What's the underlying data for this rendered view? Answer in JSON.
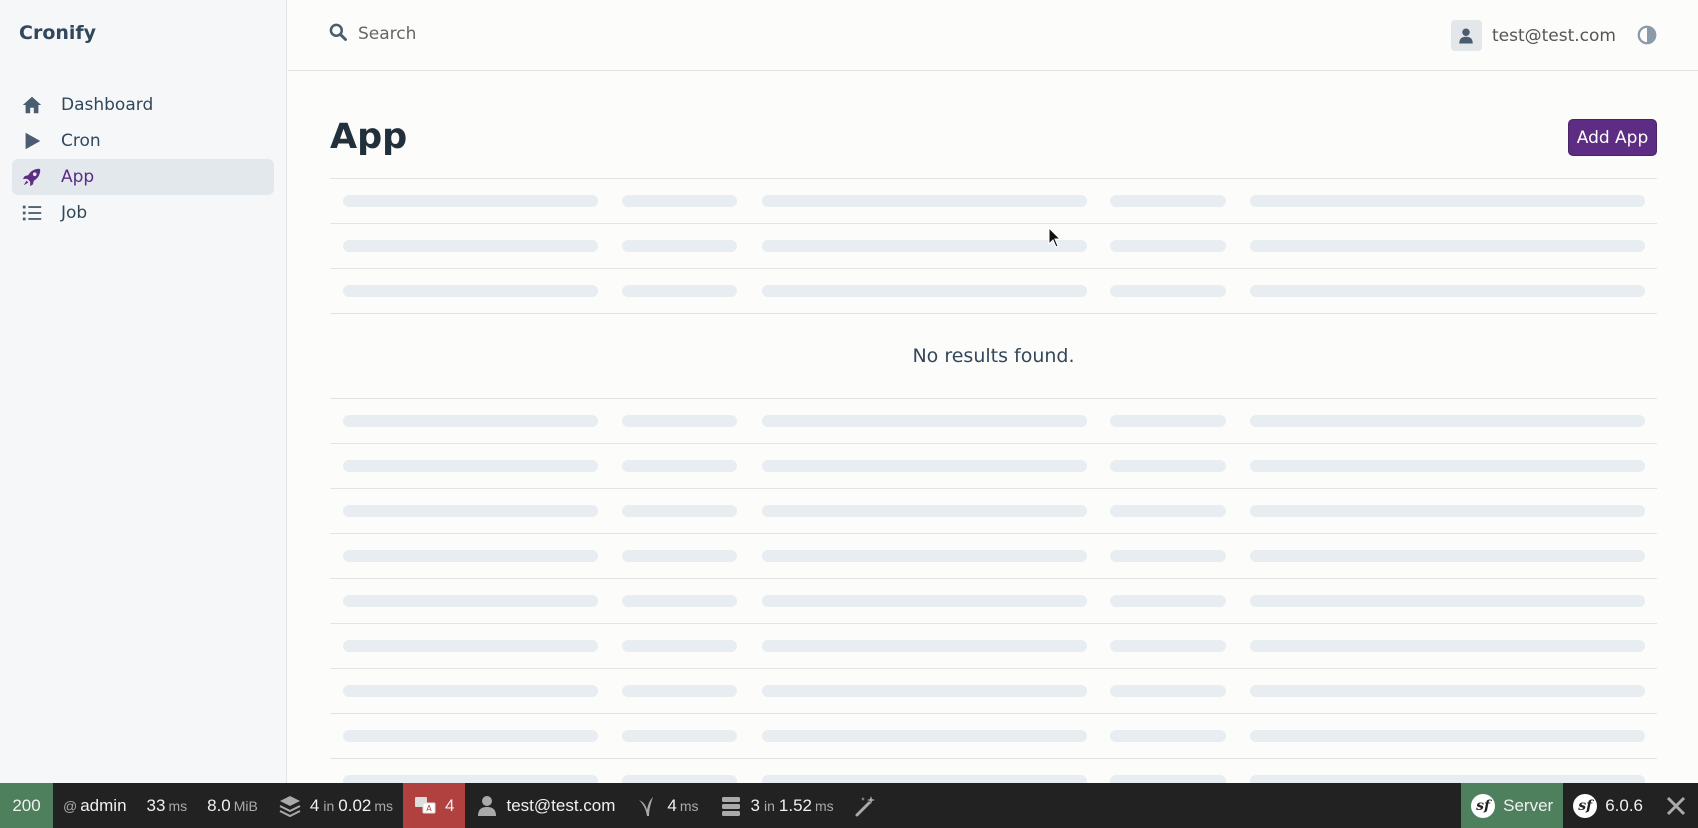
{
  "brand": "Cronify",
  "sidebar": {
    "items": [
      {
        "label": "Dashboard",
        "icon": "home-icon"
      },
      {
        "label": "Cron",
        "icon": "play-icon"
      },
      {
        "label": "App",
        "icon": "rocket-icon",
        "active": true
      },
      {
        "label": "Job",
        "icon": "list-icon"
      }
    ]
  },
  "header": {
    "search_placeholder": "Search",
    "user_email": "test@test.com"
  },
  "main": {
    "title": "App",
    "add_button": "Add App",
    "empty_message": "No results found."
  },
  "toolbar": {
    "status": "200",
    "route_prefix": "@",
    "route": "admin",
    "time_value": "33",
    "time_unit": "ms",
    "memory_value": "8.0",
    "memory_unit": "MiB",
    "cache_count": "4",
    "cache_in": "in",
    "cache_time": "0.02",
    "cache_unit": "ms",
    "translation_count": "4",
    "security_user": "test@test.com",
    "twig_time": "4",
    "twig_unit": "ms",
    "db_count": "3",
    "db_in": "in",
    "db_time": "1.52",
    "db_unit": "ms",
    "server_label": "Server",
    "symfony_version": "6.0.6"
  },
  "colors": {
    "accent": "#5c2d82",
    "toolbar_bg": "#222222",
    "status_green": "#4f805d",
    "translation_red": "#b0413e"
  }
}
